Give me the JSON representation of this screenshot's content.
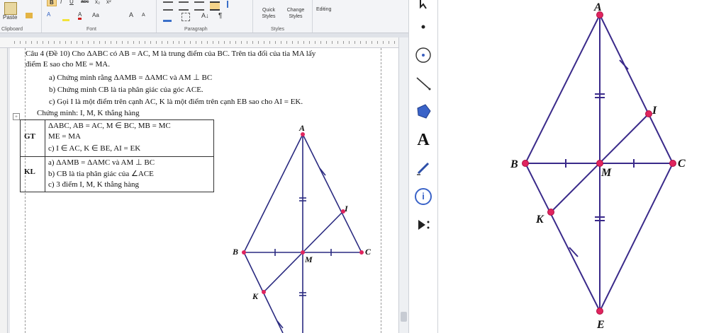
{
  "word": {
    "ribbon": {
      "paste_label": "Paste",
      "clipboard_label": "Clipboard",
      "font_label": "Font",
      "paragraph_label": "Paragraph",
      "styles_label": "Styles",
      "quick_styles_label": "Quick Styles",
      "change_styles_label": "Change Styles",
      "editing_label": "Editing",
      "font_buttons": [
        "B",
        "I",
        "U",
        "abc",
        "x₂",
        "x²",
        "A",
        "Aa",
        "A",
        "A"
      ]
    },
    "document": {
      "line1": "Câu 4 (Đề 10) Cho ΔABC có AB = AC, M là trung điểm của BC. Trên tia đối của tia MA lấy",
      "line2": "điểm E sao cho ME = MA.",
      "line3": "a) Chứng minh rằng ΔAMB = ΔAMC và AM ⊥ BC",
      "line4": "b) Chứng minh CB là tia phân giác của góc ACE.",
      "line5": "c) Gọi I là một điểm trên cạnh AC, K là một điểm trên cạnh EB sao cho AI = EK.",
      "line6": "Chứng minh: I, M, K thẳng hàng",
      "table": {
        "gt_label": "GT",
        "gt_rows": [
          "ΔABC, AB = AC, M ∈ BC, MB = MC",
          "ME = MA",
          "c) I ∈ AC, K ∈ BE, AI = EK"
        ],
        "kl_label": "KL",
        "kl_rows": [
          "a) ΔAMB = ΔAMC và AM ⊥ BC",
          "b) CB là tia phân giác của ∠ACE",
          "c) 3 điểm I, M, K thẳng hàng"
        ]
      }
    },
    "figure_labels": {
      "A": "A",
      "B": "B",
      "C": "C",
      "M": "M",
      "I": "I",
      "K": "K"
    }
  },
  "toolbar": {
    "tools": [
      "move-arrow-icon",
      "point-icon",
      "circle-icon",
      "line-icon",
      "polygon-icon",
      "text-icon",
      "pen-icon",
      "info-icon",
      "play-icon"
    ],
    "text_tool_glyph": "A",
    "info_glyph": "i"
  },
  "geometry": {
    "labels": {
      "A": "A",
      "B": "B",
      "C": "C",
      "M": "M",
      "I": "I",
      "K": "K",
      "E": "E"
    },
    "colors": {
      "segment": "#3a2a8a",
      "point": "#e0245e",
      "point_stroke": "#b01044"
    }
  }
}
